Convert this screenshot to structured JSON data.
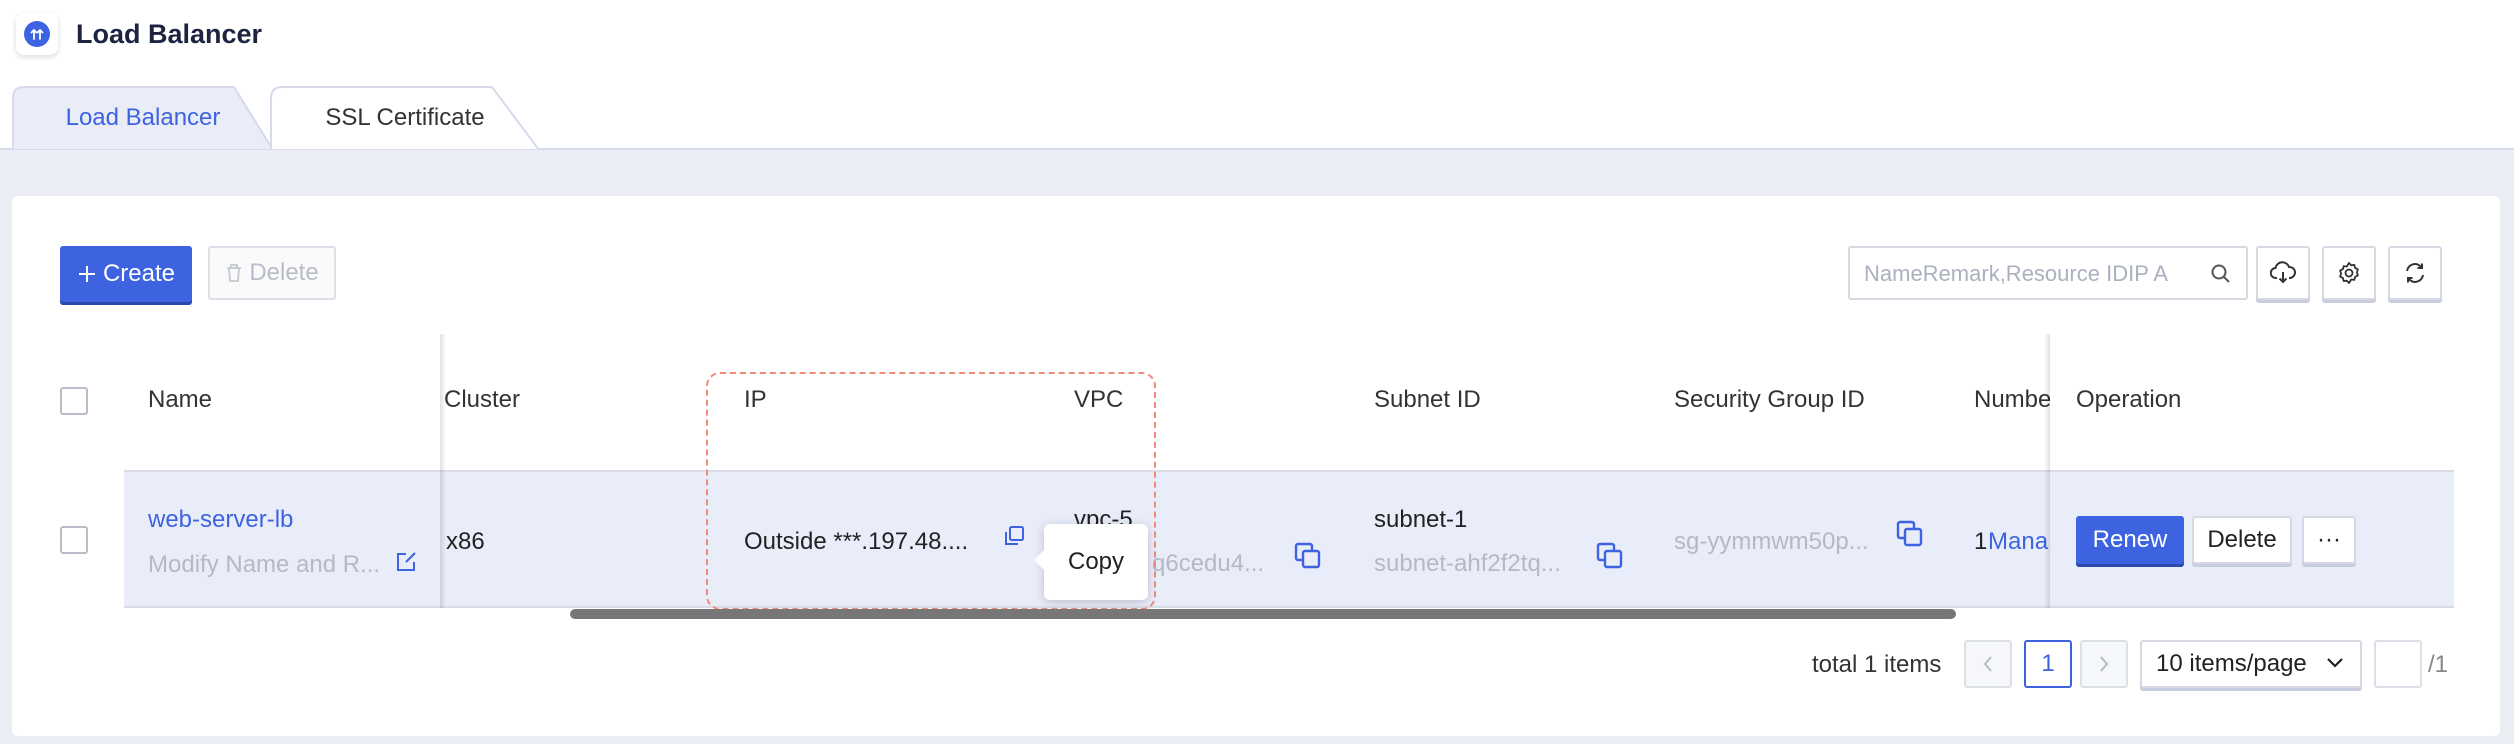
{
  "app": {
    "title": "Load Balancer",
    "logo_icon": "up-arrows-icon"
  },
  "tabs": [
    {
      "label": "Load Balancer",
      "active": true
    },
    {
      "label": "SSL Certificate",
      "active": false
    }
  ],
  "toolbar": {
    "create_label": "Create",
    "delete_label": "Delete",
    "search_placeholder": "NameRemark,Resource IDIP A",
    "search_value": ""
  },
  "table": {
    "columns": {
      "name": "Name",
      "cluster": "Cluster",
      "ip": "IP",
      "vpc": "VPC",
      "subnet": "Subnet ID",
      "security_group": "Security Group ID",
      "number": "Numbe",
      "operation": "Operation"
    },
    "row": {
      "name": "web-server-lb",
      "remark": "Modify Name and R...",
      "cluster": "x86",
      "ip": "Outside ***.197.48....",
      "vpc_name": "vpc-5",
      "vpc_id": "q6cedu4...",
      "subnet_name": "subnet-1",
      "subnet_id": "subnet-ahf2f2tq...",
      "security_group_id": "sg-yymmwm50p...",
      "number_value": "1",
      "number_link": "Mana",
      "renew_label": "Renew",
      "delete_label": "Delete",
      "more_label": "···"
    }
  },
  "tooltip": {
    "text": "Copy"
  },
  "pagination": {
    "total_text": "total 1 items",
    "current_page": "1",
    "page_size": "10 items/page",
    "total_pages": "/1",
    "prev": "<",
    "next": ">"
  },
  "colors": {
    "accent": "#3d63e0",
    "highlight": "#f08b7a",
    "row_bg": "#e9edfa"
  }
}
